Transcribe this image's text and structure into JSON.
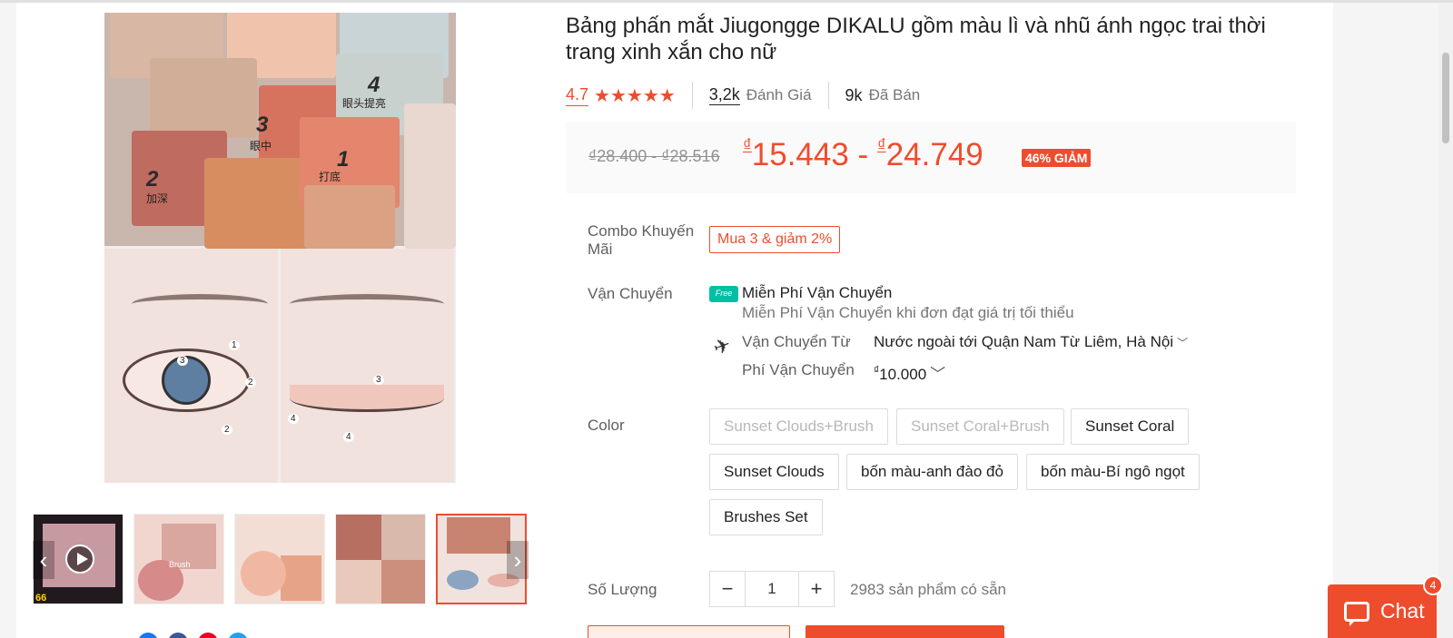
{
  "product": {
    "title": "Bảng phấn mắt Jiugongge DIKALU gồm màu lì và nhũ ánh ngọc trai thời trang xinh xắn cho nữ",
    "rating": "4.7",
    "stars": "★★★★★",
    "reviews_count": "3,2k",
    "reviews_label": "Đánh Giá",
    "sold_count": "9k",
    "sold_label": "Đã Bán"
  },
  "gallery": {
    "palette_numbers": [
      "4",
      "3",
      "1",
      "2"
    ],
    "palette_labels": [
      "眼头提亮",
      "眼中",
      "打底",
      "加深"
    ],
    "eye_markers": [
      "1",
      "2",
      "3",
      "2",
      "3",
      "4",
      "4"
    ],
    "thumb_badge": "66",
    "thumb_brush_label": "Brush"
  },
  "price": {
    "old_range": "₫28.400 - ₫28.516",
    "currency": "₫",
    "min": "15.443",
    "separator": " - ",
    "max": "24.749",
    "discount_badge": "46% GIẢM"
  },
  "combo": {
    "label": "Combo Khuyến Mãi",
    "tag": "Mua 3 & giảm 2%"
  },
  "shipping": {
    "label": "Vận Chuyển",
    "free_icon_text": "Free",
    "free_title": "Miễn Phí Vận Chuyển",
    "free_subtitle": "Miễn Phí Vận Chuyển khi đơn đạt giá trị tối thiểu",
    "from_label": "Vận Chuyển Từ",
    "from_value": "Nước ngoài tới Quận Nam Từ Liêm, Hà Nội",
    "fee_label": "Phí Vận Chuyển",
    "fee_currency": "₫",
    "fee_value": "10.000"
  },
  "color": {
    "label": "Color",
    "options": [
      {
        "label": "Sunset Clouds+Brush",
        "disabled": true
      },
      {
        "label": "Sunset Coral+Brush",
        "disabled": true
      },
      {
        "label": "Sunset Coral",
        "disabled": false
      },
      {
        "label": "Sunset Clouds",
        "disabled": false
      },
      {
        "label": "bốn màu-anh đào đỏ",
        "disabled": false
      },
      {
        "label": "bốn màu-Bí ngô ngọt",
        "disabled": false
      },
      {
        "label": "Brushes Set",
        "disabled": false
      }
    ]
  },
  "quantity": {
    "label": "Số Lượng",
    "minus": "−",
    "value": "1",
    "plus": "+",
    "stock": "2983 sản phẩm có sẵn"
  },
  "chat": {
    "label": "Chat",
    "badge": "4"
  },
  "colors": {
    "accent": "#ee4d2d",
    "free_ship": "#00bfa5"
  }
}
